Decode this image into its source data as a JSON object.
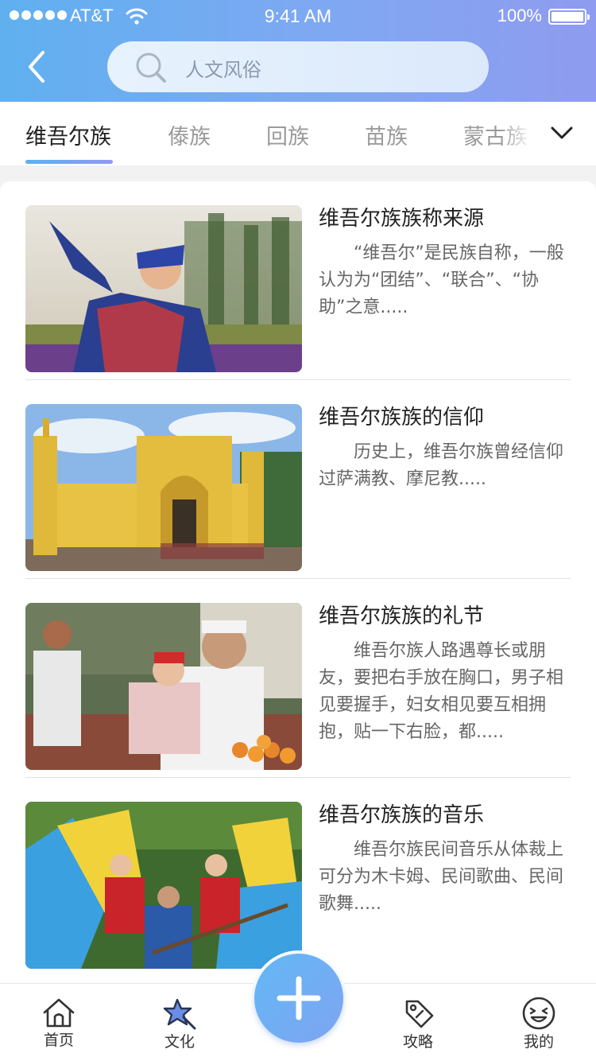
{
  "status_bar": {
    "carrier": "AT&T",
    "time": "9:41 AM",
    "battery": "100%"
  },
  "header": {
    "search_placeholder": "人文风俗"
  },
  "tabs": [
    {
      "label": "维吾尔族",
      "active": true
    },
    {
      "label": "傣族",
      "active": false
    },
    {
      "label": "回族",
      "active": false
    },
    {
      "label": "苗族",
      "active": false
    },
    {
      "label": "蒙古族",
      "active": false
    }
  ],
  "articles": [
    {
      "title": "维吾尔族族称来源",
      "desc": "“维吾尔”是民族自称，一般认为为“团结”、“联合”、“协助”之意.....",
      "image": "woman-in-traditional-dress"
    },
    {
      "title": "维吾尔族族的信仰",
      "desc": "历史上，维吾尔族曾经信仰过萨满教、摩尼教.....",
      "image": "yellow-mosque"
    },
    {
      "title": "维吾尔族族的礼节",
      "desc": "维吾尔族人路遇尊长或朋友，要把右手放在胸口，男子相见要握手，妇女相见要互相拥抱，贴一下右脸，都.....",
      "image": "family-portrait"
    },
    {
      "title": "维吾尔族族的音乐",
      "desc": "维吾尔族民间音乐从体裁上可分为木卡姆、民间歌曲、民间歌舞.....",
      "image": "dancers-and-musician"
    }
  ],
  "bottom_nav": [
    {
      "label": "首页",
      "icon": "home-icon"
    },
    {
      "label": "文化",
      "icon": "star-wand-icon"
    },
    {
      "label": "",
      "icon": "plus-icon"
    },
    {
      "label": "攻略",
      "icon": "tag-icon"
    },
    {
      "label": "我的",
      "icon": "smiley-icon"
    }
  ],
  "colors": {
    "header_start": "#5fb0f0",
    "header_end": "#8f9bf0",
    "tab_active": "#222222",
    "tab_inactive": "#9a9a9a"
  }
}
